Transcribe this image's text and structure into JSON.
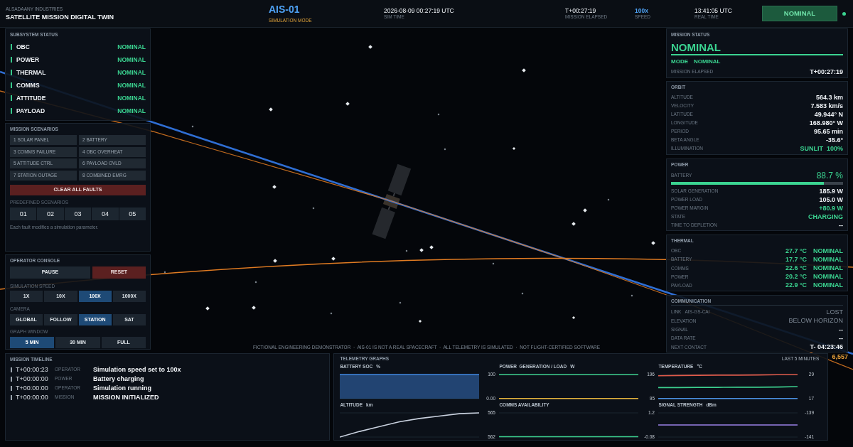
{
  "header": {
    "company": "ALSADAANY INDUSTRIES",
    "title": "SATELLITE MISSION DIGITAL TWIN",
    "mission_id": "AIS-01",
    "mode": "SIMULATION MODE",
    "readouts": [
      {
        "value": "2026-08-09 00:27:19 UTC",
        "label": "SIM TIME",
        "kind": "plain"
      },
      {
        "value": "T+00:27:19",
        "label": "MISSION ELAPSED",
        "kind": "plain"
      },
      {
        "value": "100x",
        "label": "SPEED",
        "kind": "accent"
      },
      {
        "value": "13:41:05 UTC",
        "label": "REAL TIME",
        "kind": "plain"
      }
    ],
    "status": "NOMINAL"
  },
  "subsystems": {
    "title": "SUBSYSTEM STATUS",
    "items": [
      {
        "name": "OBC",
        "status": "NOMINAL"
      },
      {
        "name": "POWER",
        "status": "NOMINAL"
      },
      {
        "name": "THERMAL",
        "status": "NOMINAL"
      },
      {
        "name": "COMMS",
        "status": "NOMINAL"
      },
      {
        "name": "ATTITUDE",
        "status": "NOMINAL"
      },
      {
        "name": "PAYLOAD",
        "status": "NOMINAL"
      }
    ]
  },
  "scenarios": {
    "title": "MISSION SCENARIOS",
    "faults": [
      "1 SOLAR PANEL",
      "2 BATTERY",
      "3 COMMS FAILURE",
      "4 OBC OVERHEAT",
      "5 ATTITUDE CTRL",
      "6 PAYLOAD OVLD",
      "7 STATION OUTAGE",
      "8 COMBINED EMRG"
    ],
    "clear_button": "CLEAR ALL FAULTS",
    "predefined_label": "PREDEFINED SCENARIOS",
    "predefined": [
      "01",
      "02",
      "03",
      "04",
      "05"
    ],
    "note": "Each fault modifies a simulation parameter."
  },
  "console": {
    "title": "OPERATOR CONSOLE",
    "pause_button": "PAUSE",
    "reset_button": "RESET",
    "groups": [
      {
        "label": "SIMULATION SPEED",
        "options": [
          {
            "label": "1X",
            "selected": false
          },
          {
            "label": "10X",
            "selected": false
          },
          {
            "label": "100X",
            "selected": true
          },
          {
            "label": "1000X",
            "selected": false
          }
        ]
      },
      {
        "label": "CAMERA",
        "options": [
          {
            "label": "GLOBAL",
            "selected": false
          },
          {
            "label": "FOLLOW",
            "selected": false
          },
          {
            "label": "STATION",
            "selected": true
          },
          {
            "label": "SAT",
            "selected": false
          }
        ]
      },
      {
        "label": "GRAPH WINDOW",
        "options": [
          {
            "label": "5 MIN",
            "selected": true
          },
          {
            "label": "30 MIN",
            "selected": false
          },
          {
            "label": "FULL",
            "selected": false
          }
        ]
      }
    ]
  },
  "viewport": {
    "disclaimer": "FICTIONAL ENGINEERING DEMONSTRATOR  ·  AIS-01 IS NOT A REAL SPACECRAFT  ·  ALL TELEMETRY IS SIMULATED  ·  NOT FLIGHT-CERTIFIED SOFTWARE",
    "scene_label": "6,557"
  },
  "mission_status": {
    "title": "MISSION STATUS",
    "status": "NOMINAL",
    "mode_label": "MODE",
    "mode": "NOMINAL",
    "elapsed_label": "MISSION ELAPSED",
    "elapsed": "T+00:27:19"
  },
  "orbit": {
    "title": "ORBIT",
    "rows": [
      {
        "label": "ALTITUDE",
        "value": "564.3 km",
        "kind": "plain"
      },
      {
        "label": "VELOCITY",
        "value": "7.583 km/s",
        "kind": "plain"
      },
      {
        "label": "LATITUDE",
        "value": "49.944° N",
        "kind": "plain"
      },
      {
        "label": "LONGITUDE",
        "value": "168.980° W",
        "kind": "plain"
      },
      {
        "label": "PERIOD",
        "value": "95.65 min",
        "kind": "plain"
      },
      {
        "label": "BETA ANGLE",
        "value": "-35.6°",
        "kind": "plain"
      },
      {
        "label": "ILLUMINATION",
        "value": "SUNLIT  100%",
        "kind": "good"
      }
    ]
  },
  "power": {
    "title": "POWER",
    "battery": {
      "label": "BATTERY",
      "value": "88.7 %",
      "level": 0.887
    },
    "rows": [
      {
        "label": "SOLAR GENERATION",
        "value": "185.9 W",
        "kind": "plain"
      },
      {
        "label": "POWER LOAD",
        "value": "105.0 W",
        "kind": "plain"
      },
      {
        "label": "POWER MARGIN",
        "value": "+80.9 W",
        "kind": "good"
      },
      {
        "label": "STATE",
        "value": "CHARGING",
        "kind": "good"
      },
      {
        "label": "TIME TO DEPLETION",
        "value": "--",
        "kind": "plain"
      }
    ]
  },
  "thermal": {
    "title": "THERMAL",
    "rows": [
      {
        "label": "OBC",
        "value": "27.7 °C",
        "status": "NOMINAL"
      },
      {
        "label": "BATTERY",
        "value": "17.7 °C",
        "status": "NOMINAL"
      },
      {
        "label": "COMMS",
        "value": "22.6 °C",
        "status": "NOMINAL"
      },
      {
        "label": "POWER",
        "value": "20.2 °C",
        "status": "NOMINAL"
      },
      {
        "label": "PAYLOAD",
        "value": "22.9 °C",
        "status": "NOMINAL"
      }
    ]
  },
  "communication": {
    "title": "COMMUNICATION",
    "rows": [
      {
        "label": "LINK",
        "station": "AIS-GS-CAI",
        "value": "LOST",
        "kind": "muted"
      },
      {
        "label": "ELEVATION",
        "value": "BELOW HORIZON",
        "kind": "muted"
      },
      {
        "label": "SIGNAL",
        "value": "--",
        "kind": "plain"
      },
      {
        "label": "DATA RATE",
        "value": "--",
        "kind": "plain"
      },
      {
        "label": "NEXT CONTACT",
        "value": "T- 04:23:46",
        "kind": "plain"
      }
    ]
  },
  "timeline": {
    "title": "MISSION TIMELINE",
    "events": [
      {
        "time": "T+00:00:23",
        "source": "OPERATOR",
        "message": "Simulation speed set to 100x"
      },
      {
        "time": "T+00:00:00",
        "source": "POWER",
        "message": "Battery charging"
      },
      {
        "time": "T+00:00:00",
        "source": "OPERATOR",
        "message": "Simulation running"
      },
      {
        "time": "T+00:00:00",
        "source": "MISSION",
        "message": "MISSION INITIALIZED"
      }
    ]
  },
  "telemetry": {
    "title": "TELEMETRY GRAPHS",
    "window": "LAST 5 MINUTES",
    "graphs": [
      {
        "chart_data": {
          "type": "area",
          "title": "BATTERY SOC",
          "ylabel": "%",
          "categories": [
            null,
            null,
            null,
            null,
            null,
            null,
            null,
            null
          ],
          "ylim": [
            0,
            100
          ],
          "yticks": [
            {
              "value": 100,
              "label": "100"
            },
            {
              "value": 0,
              "label": "0.00"
            }
          ],
          "series": [
            {
              "color": "#3f86e0",
              "values": [
                100,
                100,
                100,
                100,
                100,
                100,
                100,
                100
              ]
            }
          ]
        }
      },
      {
        "chart_data": {
          "type": "line",
          "title": "POWER  GENERATION / LOAD",
          "ylabel": "W",
          "categories": [
            null,
            null,
            null,
            null,
            null,
            null,
            null,
            null
          ],
          "ylim": [
            95,
            196
          ],
          "yticks": [
            {
              "value": 196,
              "label": "196"
            },
            {
              "value": 95,
              "label": "95"
            }
          ],
          "series": [
            {
              "color": "#3ccf8e",
              "values": [
                195,
                195,
                195,
                195,
                195,
                195,
                195,
                195
              ]
            },
            {
              "color": "#e3b23c",
              "values": [
                96,
                96,
                96,
                96,
                96,
                96,
                96,
                96
              ]
            }
          ]
        }
      },
      {
        "chart_data": {
          "type": "line",
          "title": "TEMPERATURE",
          "ylabel": "°C",
          "categories": [
            null,
            null,
            null,
            null,
            null,
            null,
            null,
            null
          ],
          "ylim": [
            17,
            29
          ],
          "yticks": [
            {
              "value": 29,
              "label": "29"
            },
            {
              "value": 17,
              "label": "17"
            }
          ],
          "series": [
            {
              "color": "#e05a4a",
              "values": [
                28.4,
                28.5,
                28.6,
                28.7,
                28.7,
                28.8,
                28.9,
                28.9
              ]
            },
            {
              "color": "#3ccf8e",
              "values": [
                22.5,
                22.5,
                22.6,
                22.6,
                22.7,
                22.7,
                22.8,
                23.0
              ]
            },
            {
              "color": "#4a90e2",
              "values": [
                17.1,
                17.1,
                17.1,
                17.1,
                17.1,
                17.1,
                17.1,
                17.1
              ]
            }
          ]
        }
      },
      {
        "chart_data": {
          "type": "line",
          "title": "ALTITUDE",
          "ylabel": "km",
          "categories": [
            null,
            null,
            null,
            null,
            null,
            null,
            null,
            null
          ],
          "ylim": [
            562,
            565
          ],
          "yticks": [
            {
              "value": 565,
              "label": "565"
            },
            {
              "value": 562,
              "label": "562"
            }
          ],
          "series": [
            {
              "color": "#c9d1de",
              "values": [
                562.0,
                562.7,
                563.3,
                563.9,
                564.3,
                564.6,
                564.9,
                565.0
              ]
            }
          ]
        }
      },
      {
        "chart_data": {
          "type": "line",
          "title": "COMMS AVAILABILITY",
          "categories": [
            null,
            null,
            null,
            null,
            null,
            null,
            null,
            null
          ],
          "ylim": [
            -0.08,
            1.2
          ],
          "yticks": [
            {
              "value": 1.2,
              "label": "1.2"
            },
            {
              "value": -0.08,
              "label": "-0.08"
            }
          ],
          "series": [
            {
              "color": "#3ccf8e",
              "values": [
                -0.06,
                -0.06,
                -0.06,
                -0.06,
                -0.06,
                -0.06,
                -0.06,
                -0.06
              ]
            }
          ]
        }
      },
      {
        "chart_data": {
          "type": "line",
          "title": "SIGNAL STRENGTH",
          "ylabel": "dBm",
          "categories": [
            null,
            null,
            null,
            null,
            null,
            null,
            null,
            null
          ],
          "ylim": [
            -141,
            -139
          ],
          "yticks": [
            {
              "value": -139,
              "label": "-139"
            },
            {
              "value": -141,
              "label": "-141"
            }
          ],
          "series": [
            {
              "color": "#9a80e6",
              "values": [
                -140,
                -140,
                -140,
                -140,
                -140,
                -140,
                -140,
                -140
              ]
            }
          ]
        }
      }
    ]
  }
}
